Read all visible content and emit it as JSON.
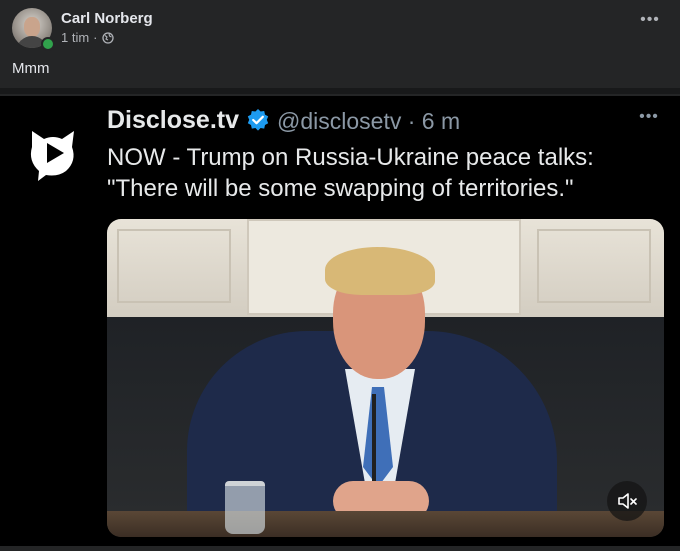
{
  "post": {
    "author": "Carl Norberg",
    "time": "1 tim",
    "separator": "·",
    "caption": "Mmm",
    "more_icon": "more-horizontal-icon"
  },
  "tweet": {
    "display_name": "Disclose.tv",
    "handle_time": "@disclosetv · 6 m",
    "text": "NOW - Trump on Russia-Ukraine peace talks: \"There will be some swapping of territories.\"",
    "verified_color": "#1d9bf0",
    "media_control": "volume-muted-icon"
  },
  "colors": {
    "page_bg": "#242526",
    "tweet_bg": "#000000",
    "online": "#31a24c"
  }
}
